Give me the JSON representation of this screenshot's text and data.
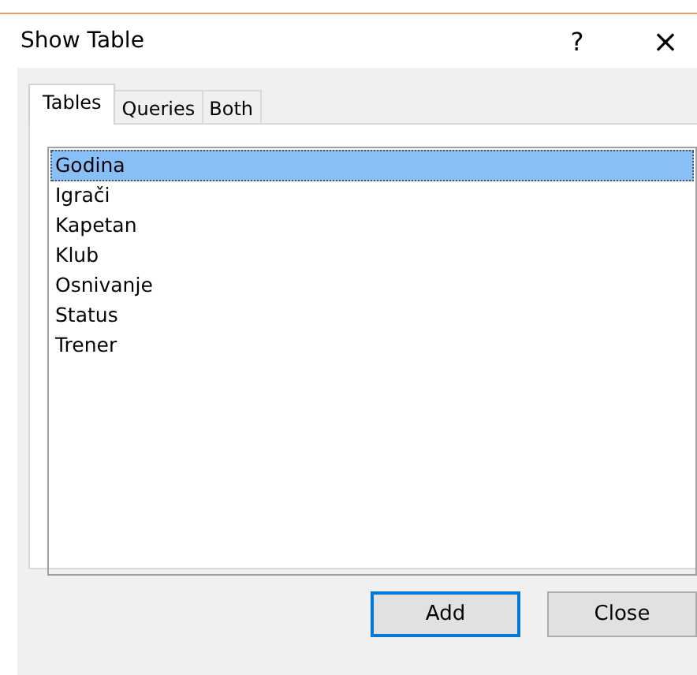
{
  "window": {
    "title": "Show Table",
    "help": "?",
    "close": "×"
  },
  "tabs": [
    {
      "label": "Tables",
      "selected": true
    },
    {
      "label": "Queries",
      "selected": false
    },
    {
      "label": "Both",
      "selected": false
    }
  ],
  "list": [
    {
      "label": "Godina",
      "selected": true
    },
    {
      "label": "Igrači",
      "selected": false
    },
    {
      "label": "Kapetan",
      "selected": false
    },
    {
      "label": "Klub",
      "selected": false
    },
    {
      "label": "Osnivanje",
      "selected": false
    },
    {
      "label": "Status",
      "selected": false
    },
    {
      "label": "Trener",
      "selected": false
    }
  ],
  "buttons": [
    {
      "label": "Add",
      "focused": true
    },
    {
      "label": "Close",
      "focused": false
    }
  ]
}
